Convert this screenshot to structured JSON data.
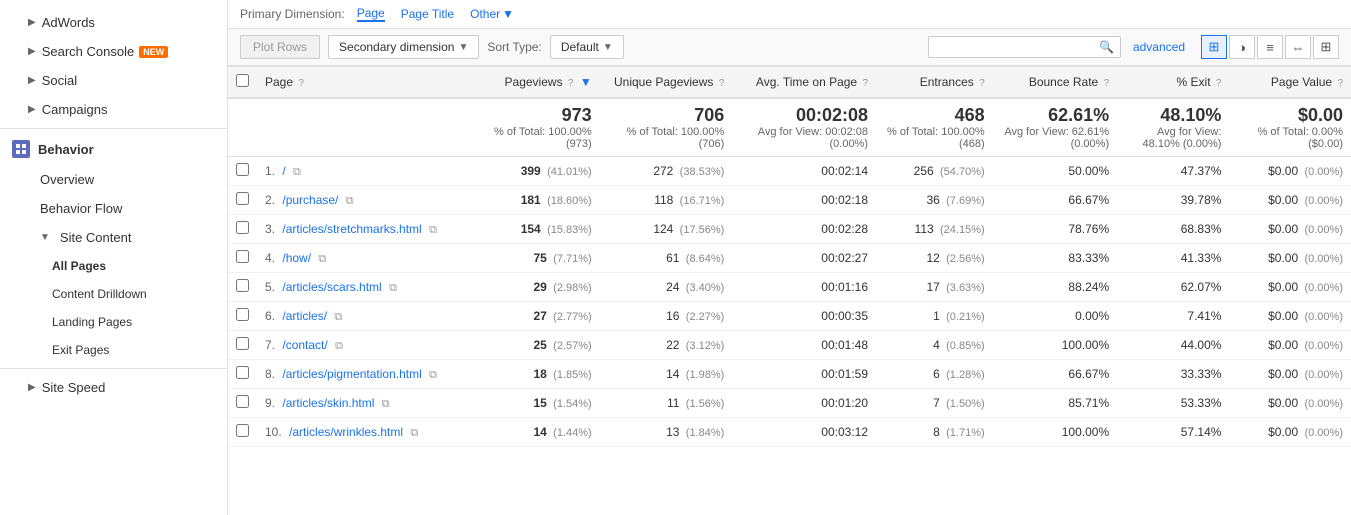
{
  "dimensions": {
    "label": "Primary Dimension:",
    "page": "Page",
    "pageTitle": "Page Title",
    "other": "Other"
  },
  "toolbar": {
    "plotRows": "Plot Rows",
    "secondaryDimension": "Secondary dimension",
    "sortType": "Sort Type:",
    "default": "Default",
    "advanced": "advanced",
    "searchPlaceholder": ""
  },
  "sidebar": {
    "adwords": "AdWords",
    "searchConsole": "Search Console",
    "newBadge": "NEW",
    "social": "Social",
    "campaigns": "Campaigns",
    "behavior": "Behavior",
    "overview": "Overview",
    "behaviorFlow": "Behavior Flow",
    "siteContent": "Site Content",
    "allPages": "All Pages",
    "contentDrilldown": "Content Drilldown",
    "landingPages": "Landing Pages",
    "exitPages": "Exit Pages",
    "siteSpeed": "Site Speed"
  },
  "table": {
    "columns": {
      "page": "Page",
      "pageviews": "Pageviews",
      "uniquePageviews": "Unique Pageviews",
      "avgTime": "Avg. Time on Page",
      "entrances": "Entrances",
      "bounceRate": "Bounce Rate",
      "exitPct": "% Exit",
      "pageValue": "Page Value"
    },
    "summary": {
      "pageviews": "973",
      "pageviewsSub": "% of Total: 100.00% (973)",
      "uniquePageviews": "706",
      "uniquePageviewsSub": "% of Total: 100.00% (706)",
      "avgTime": "00:02:08",
      "avgTimeSub": "Avg for View: 00:02:08 (0.00%)",
      "entrances": "468",
      "entrancesSub": "% of Total: 100.00% (468)",
      "bounceRate": "62.61%",
      "bounceRateSub": "Avg for View: 62.61% (0.00%)",
      "exitPct": "48.10%",
      "exitPctSub": "Avg for View: 48.10% (0.00%)",
      "pageValue": "$0.00",
      "pageValueSub": "% of Total: 0.00% ($0.00)"
    },
    "rows": [
      {
        "num": "1.",
        "page": "/",
        "pageviews": "399",
        "pageviewsPct": "(41.01%)",
        "uniquePageviews": "272",
        "uniquePageviewsPct": "(38.53%)",
        "avgTime": "00:02:14",
        "entrances": "256",
        "entrancesPct": "(54.70%)",
        "bounceRate": "50.00%",
        "exitPct": "47.37%",
        "pageValue": "$0.00",
        "pageValuePct": "(0.00%)"
      },
      {
        "num": "2.",
        "page": "/purchase/",
        "pageviews": "181",
        "pageviewsPct": "(18.60%)",
        "uniquePageviews": "118",
        "uniquePageviewsPct": "(16.71%)",
        "avgTime": "00:02:18",
        "entrances": "36",
        "entrancesPct": "(7.69%)",
        "bounceRate": "66.67%",
        "exitPct": "39.78%",
        "pageValue": "$0.00",
        "pageValuePct": "(0.00%)"
      },
      {
        "num": "3.",
        "page": "/articles/stretchmarks.html",
        "pageviews": "154",
        "pageviewsPct": "(15.83%)",
        "uniquePageviews": "124",
        "uniquePageviewsPct": "(17.56%)",
        "avgTime": "00:02:28",
        "entrances": "113",
        "entrancesPct": "(24.15%)",
        "bounceRate": "78.76%",
        "exitPct": "68.83%",
        "pageValue": "$0.00",
        "pageValuePct": "(0.00%)"
      },
      {
        "num": "4.",
        "page": "/how/",
        "pageviews": "75",
        "pageviewsPct": "(7.71%)",
        "uniquePageviews": "61",
        "uniquePageviewsPct": "(8.64%)",
        "avgTime": "00:02:27",
        "entrances": "12",
        "entrancesPct": "(2.56%)",
        "bounceRate": "83.33%",
        "exitPct": "41.33%",
        "pageValue": "$0.00",
        "pageValuePct": "(0.00%)"
      },
      {
        "num": "5.",
        "page": "/articles/scars.html",
        "pageviews": "29",
        "pageviewsPct": "(2.98%)",
        "uniquePageviews": "24",
        "uniquePageviewsPct": "(3.40%)",
        "avgTime": "00:01:16",
        "entrances": "17",
        "entrancesPct": "(3.63%)",
        "bounceRate": "88.24%",
        "exitPct": "62.07%",
        "pageValue": "$0.00",
        "pageValuePct": "(0.00%)"
      },
      {
        "num": "6.",
        "page": "/articles/",
        "pageviews": "27",
        "pageviewsPct": "(2.77%)",
        "uniquePageviews": "16",
        "uniquePageviewsPct": "(2.27%)",
        "avgTime": "00:00:35",
        "entrances": "1",
        "entrancesPct": "(0.21%)",
        "bounceRate": "0.00%",
        "exitPct": "7.41%",
        "pageValue": "$0.00",
        "pageValuePct": "(0.00%)"
      },
      {
        "num": "7.",
        "page": "/contact/",
        "pageviews": "25",
        "pageviewsPct": "(2.57%)",
        "uniquePageviews": "22",
        "uniquePageviewsPct": "(3.12%)",
        "avgTime": "00:01:48",
        "entrances": "4",
        "entrancesPct": "(0.85%)",
        "bounceRate": "100.00%",
        "exitPct": "44.00%",
        "pageValue": "$0.00",
        "pageValuePct": "(0.00%)"
      },
      {
        "num": "8.",
        "page": "/articles/pigmentation.html",
        "pageviews": "18",
        "pageviewsPct": "(1.85%)",
        "uniquePageviews": "14",
        "uniquePageviewsPct": "(1.98%)",
        "avgTime": "00:01:59",
        "entrances": "6",
        "entrancesPct": "(1.28%)",
        "bounceRate": "66.67%",
        "exitPct": "33.33%",
        "pageValue": "$0.00",
        "pageValuePct": "(0.00%)"
      },
      {
        "num": "9.",
        "page": "/articles/skin.html",
        "pageviews": "15",
        "pageviewsPct": "(1.54%)",
        "uniquePageviews": "11",
        "uniquePageviewsPct": "(1.56%)",
        "avgTime": "00:01:20",
        "entrances": "7",
        "entrancesPct": "(1.50%)",
        "bounceRate": "85.71%",
        "exitPct": "53.33%",
        "pageValue": "$0.00",
        "pageValuePct": "(0.00%)"
      },
      {
        "num": "10.",
        "page": "/articles/wrinkles.html",
        "pageviews": "14",
        "pageviewsPct": "(1.44%)",
        "uniquePageviews": "13",
        "uniquePageviewsPct": "(1.84%)",
        "avgTime": "00:03:12",
        "entrances": "8",
        "entrancesPct": "(1.71%)",
        "bounceRate": "100.00%",
        "exitPct": "57.14%",
        "pageValue": "$0.00",
        "pageValuePct": "(0.00%)"
      }
    ]
  }
}
